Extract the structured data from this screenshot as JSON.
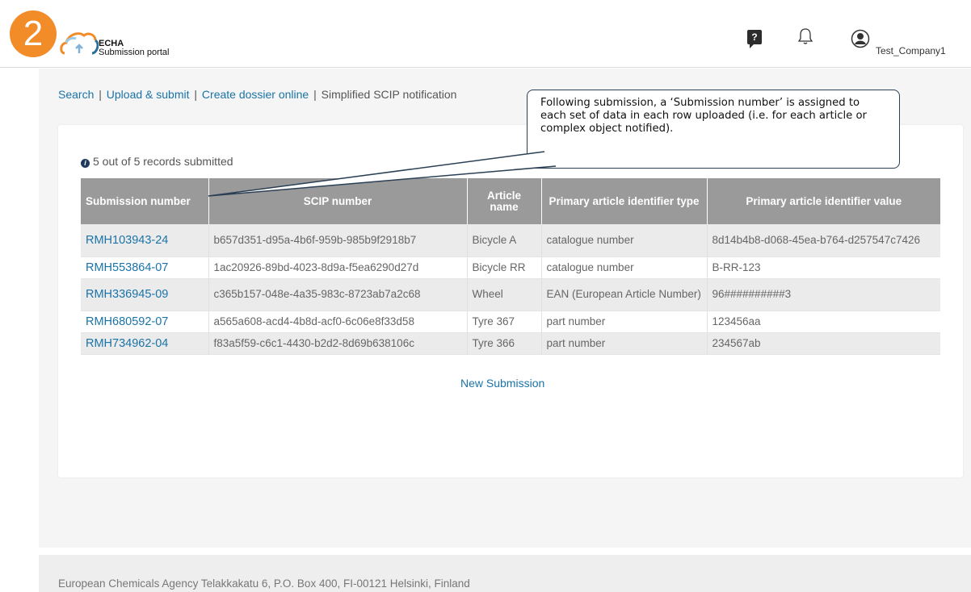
{
  "step_number": "2",
  "logo": {
    "line1": "ECHA",
    "line2": "Submission portal"
  },
  "header": {
    "company": "Test_Company1",
    "help_icon": "question-icon",
    "bell_icon": "bell-icon",
    "user_icon": "user-icon"
  },
  "nav": {
    "search": "Search",
    "upload": "Upload & submit",
    "create": "Create dossier online",
    "simplified": "Simplified SCIP notification",
    "separator": "|"
  },
  "records_status": "5 out of 5 records submitted",
  "table": {
    "headers": [
      "Submission number",
      "SCIP number",
      "Article name",
      "Primary article identifier type",
      "Primary article identifier value"
    ],
    "rows": [
      {
        "submission": "RMH103943-24",
        "scip": "b657d351-d95a-4b6f-959b-985b9f2918b7",
        "article": "Bicycle A",
        "id_type": "catalogue number",
        "id_value": "8d14b4b8-d068-45ea-b764-d257547c7426"
      },
      {
        "submission": "RMH553864-07",
        "scip": "1ac20926-89bd-4023-8d9a-f5ea6290d27d",
        "article": "Bicycle RR",
        "id_type": "catalogue number",
        "id_value": "B-RR-123"
      },
      {
        "submission": "RMH336945-09",
        "scip": "c365b157-048e-4a35-983c-8723ab7a2c68",
        "article": "Wheel",
        "id_type": "EAN (European Article Number)",
        "id_value": "96##########3"
      },
      {
        "submission": "RMH680592-07",
        "scip": "a565a608-acd4-4b8d-acf0-6c06e8f33d58",
        "article": "Tyre 367",
        "id_type": "part number",
        "id_value": "123456aa"
      },
      {
        "submission": "RMH734962-04",
        "scip": "f83a5f59-c6c1-4430-b2d2-8d69b638106c",
        "article": "Tyre 366",
        "id_type": "part number",
        "id_value": "234567ab"
      }
    ]
  },
  "new_submission": "New Submission",
  "callout_text": "Following submission, a ‘Submission number’ is assigned to each set of data in each row uploaded (i.e. for each article or complex object notified).",
  "footer": "European Chemicals Agency Telakkakatu 6, P.O. Box 400, FI-00121 Helsinki, Finland",
  "colors": {
    "accent": "#f28c28",
    "link": "#1a73a8",
    "table_header": "#9a9a9a"
  }
}
